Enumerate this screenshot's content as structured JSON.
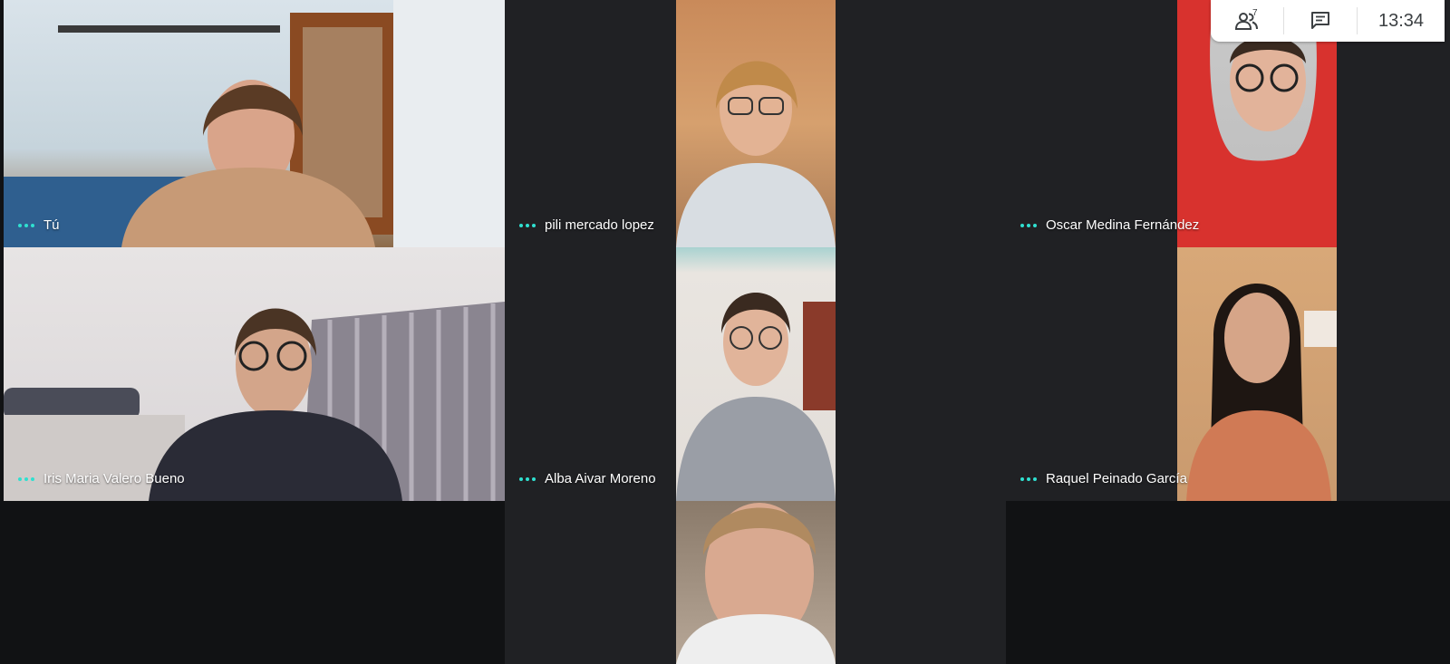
{
  "topbar": {
    "participants_count": "7",
    "time": "13:34",
    "participants_icon": "people-icon",
    "chat_icon": "chat-icon"
  },
  "tiles": [
    {
      "name": "Tú"
    },
    {
      "name": "pili mercado lopez"
    },
    {
      "name": "Oscar Medina Fernández"
    },
    {
      "name": "Iris Maria Valero Bueno"
    },
    {
      "name": "Alba Aivar Moreno"
    },
    {
      "name": "Raquel Peinado García"
    },
    {
      "name": ""
    }
  ],
  "colors": {
    "background": "#111214",
    "tile": "#202124",
    "dots": "#2fe0d0"
  }
}
